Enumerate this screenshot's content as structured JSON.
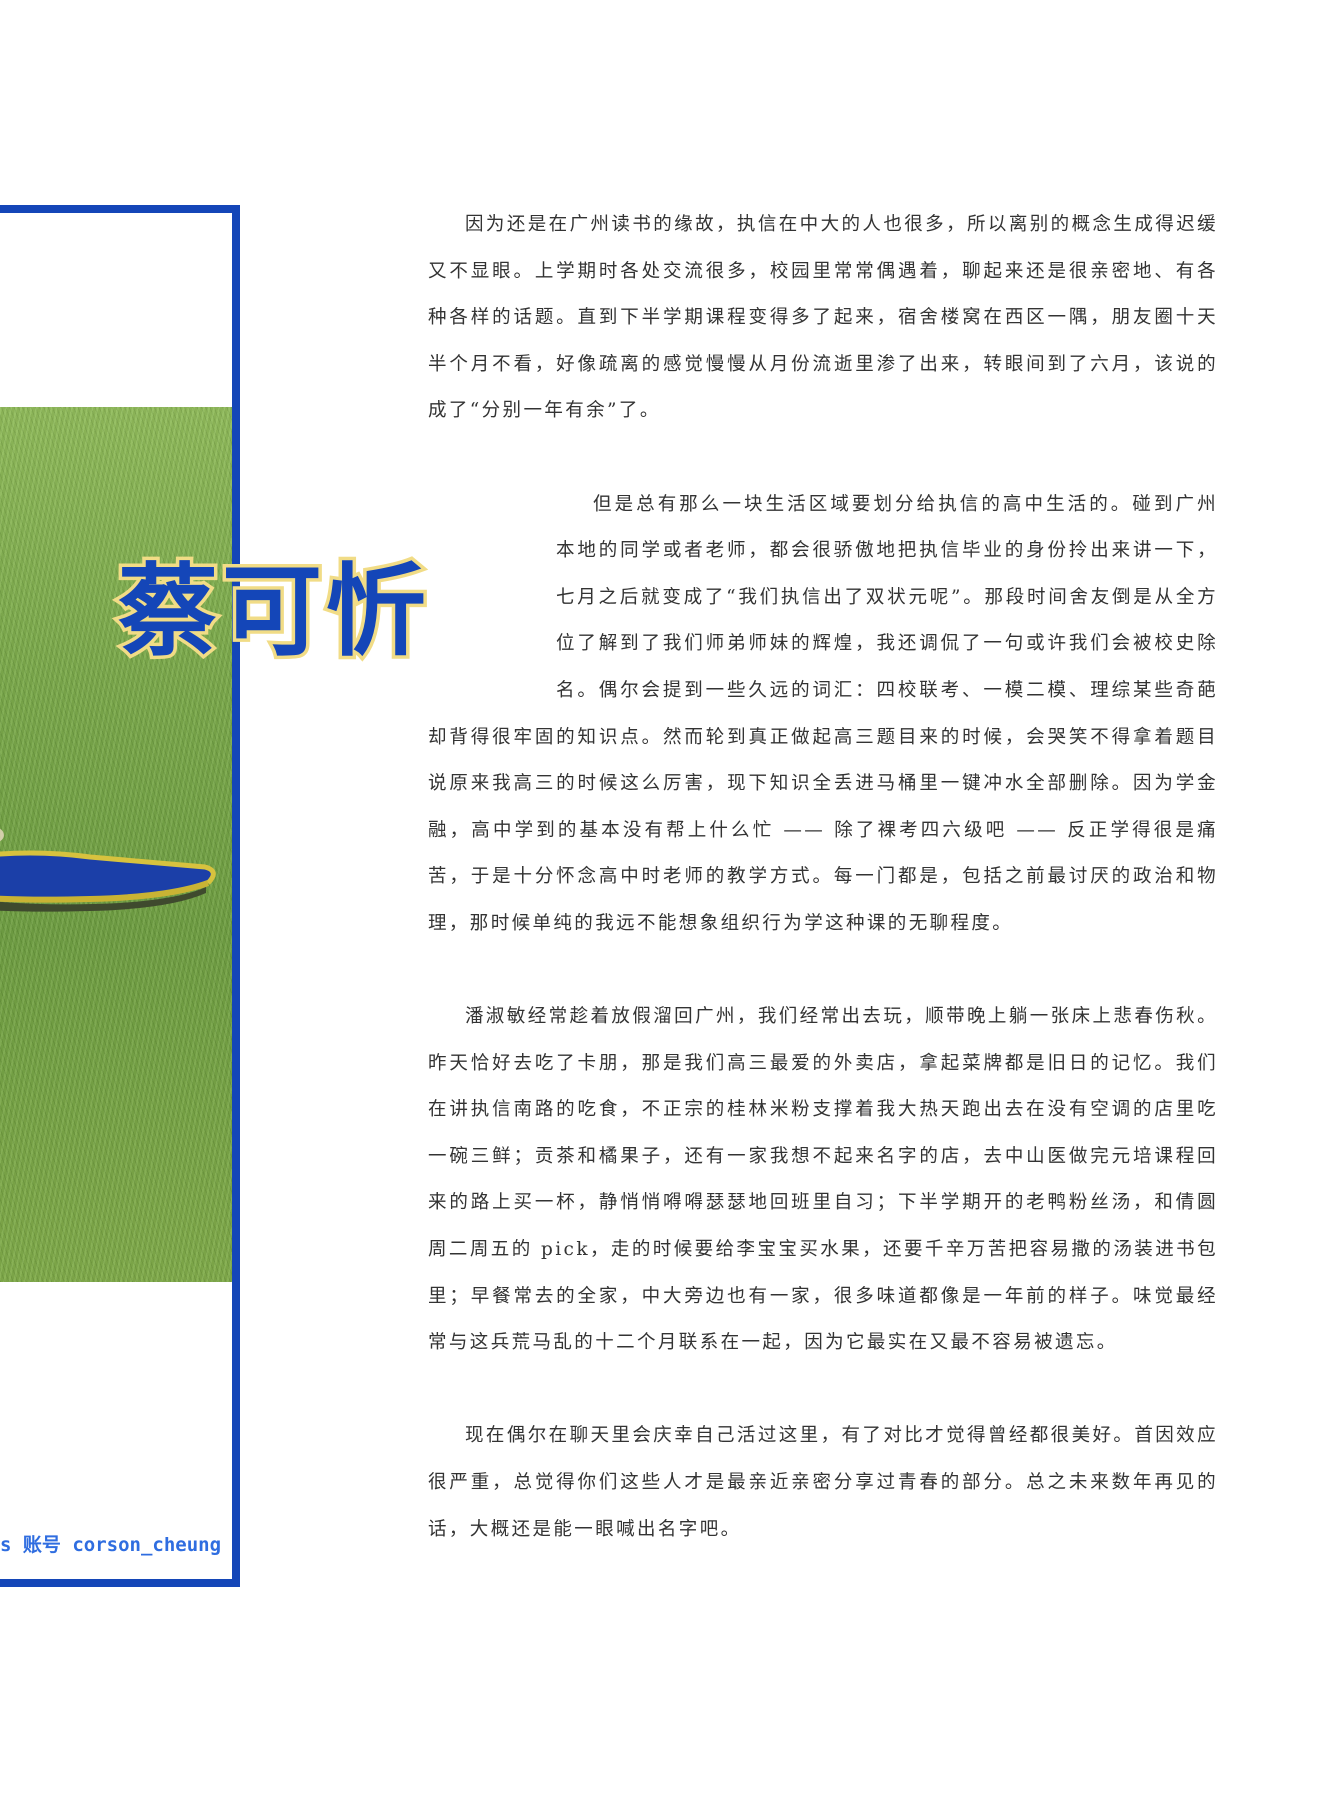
{
  "header": {
    "name_title": "蔡可忻"
  },
  "photo": {
    "watermark": "s 账号 corson_cheung",
    "accent_color": "#1446b8",
    "title_outline_color": "#f1dc86"
  },
  "article": {
    "paragraphs": [
      "因为还是在广州读书的缘故，执信在中大的人也很多，所以离别的概念生成得迟缓又不显眼。上学期时各处交流很多，校园里常常偶遇着，聊起来还是很亲密地、有各种各样的话题。直到下半学期课程变得多了起来，宿舍楼窝在西区一隅，朋友圈十天半个月不看，好像疏离的感觉慢慢从月份流逝里渗了出来，转眼间到了六月，该说的成了“分别一年有余”了。",
      "但是总有那么一块生活区域要划分给执信的高中生活的。碰到广州本地的同学或者老师，都会很骄傲地把执信毕业的身份拎出来讲一下，七月之后就变成了“我们执信出了双状元呢”。那段时间舍友倒是从全方位了解到了我们师弟师妹的辉煌，我还调侃了一句或许我们会被校史除名。偶尔会提到一些久远的词汇：四校联考、一模二模、理综某些奇葩却背得很牢固的知识点。然而轮到真正做起高三题目来的时候，会哭笑不得拿着题目说原来我高三的时候这么厉害，现下知识全丢进马桶里一键冲水全部删除。因为学金融，高中学到的基本没有帮上什么忙 —— 除了裸考四六级吧 —— 反正学得很是痛苦，于是十分怀念高中时老师的教学方式。每一门都是，包括之前最讨厌的政治和物理，那时候单纯的我远不能想象组织行为学这种课的无聊程度。",
      "潘淑敏经常趁着放假溜回广州，我们经常出去玩，顺带晚上躺一张床上悲春伤秋。昨天恰好去吃了卡朋，那是我们高三最爱的外卖店，拿起菜牌都是旧日的记忆。我们在讲执信南路的吃食，不正宗的桂林米粉支撑着我大热天跑出去在没有空调的店里吃一碗三鲜；贡茶和橘果子，还有一家我想不起来名字的店，去中山医做完元培课程回来的路上买一杯，静悄悄嘚嘚瑟瑟地回班里自习；下半学期开的老鸭粉丝汤，和倩圆周二周五的 pick，走的时候要给李宝宝买水果，还要千辛万苦把容易撒的汤装进书包里；早餐常去的全家，中大旁边也有一家，很多味道都像是一年前的样子。味觉最经常与这兵荒马乱的十二个月联系在一起，因为它最实在又最不容易被遗忘。",
      "现在偶尔在聊天里会庆幸自己活过这里，有了对比才觉得曾经都很美好。首因效应很严重，总觉得你们这些人才是最亲近亲密分享过青春的部分。总之未来数年再见的话，大概还是能一眼喊出名字吧。"
    ]
  }
}
